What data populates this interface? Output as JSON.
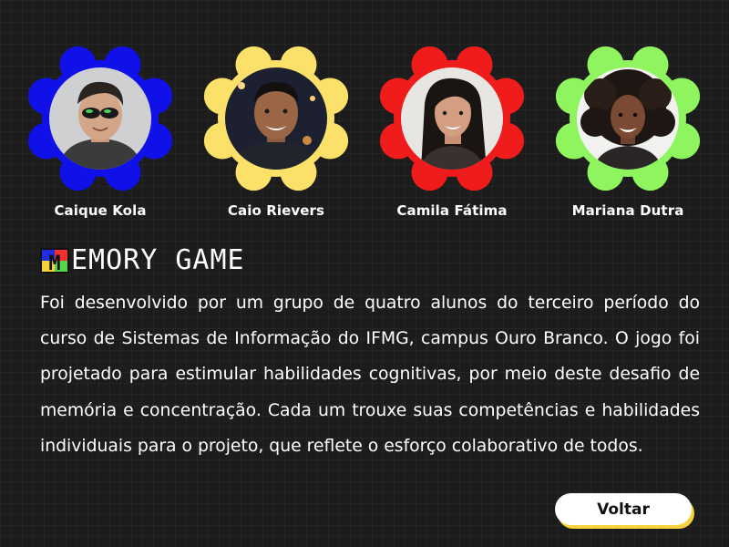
{
  "team": [
    {
      "name": "Caique Kola",
      "frame_color": "#1010e8",
      "photo": "avatar-with-sunglasses"
    },
    {
      "name": "Caio Rievers",
      "frame_color": "#fbe06a",
      "photo": "avatar-smiling-man"
    },
    {
      "name": "Camila Fátima",
      "frame_color": "#f01c1c",
      "photo": "avatar-long-dark-hair"
    },
    {
      "name": "Mariana Dutra",
      "frame_color": "#8ef55e",
      "photo": "avatar-curly-hair"
    }
  ],
  "logo_letter": "M",
  "logo_colors": [
    "#1e2ee0",
    "#f23030",
    "#f6d23a",
    "#55d64a"
  ],
  "title": "EMORY GAME",
  "description": "Foi desenvolvido por um grupo de quatro alunos do terceiro período do curso de Sistemas de Informação do IFMG, campus Ouro Branco. O jogo foi projetado para estimular habilidades cognitivas, por meio deste desafio de memória e concentração. Cada um trouxe suas competências e habilidades individuais para o projeto, que reflete o esforço colaborativo de todos.",
  "back_button": {
    "label": "Voltar",
    "shadow_color": "#f6d23a"
  }
}
